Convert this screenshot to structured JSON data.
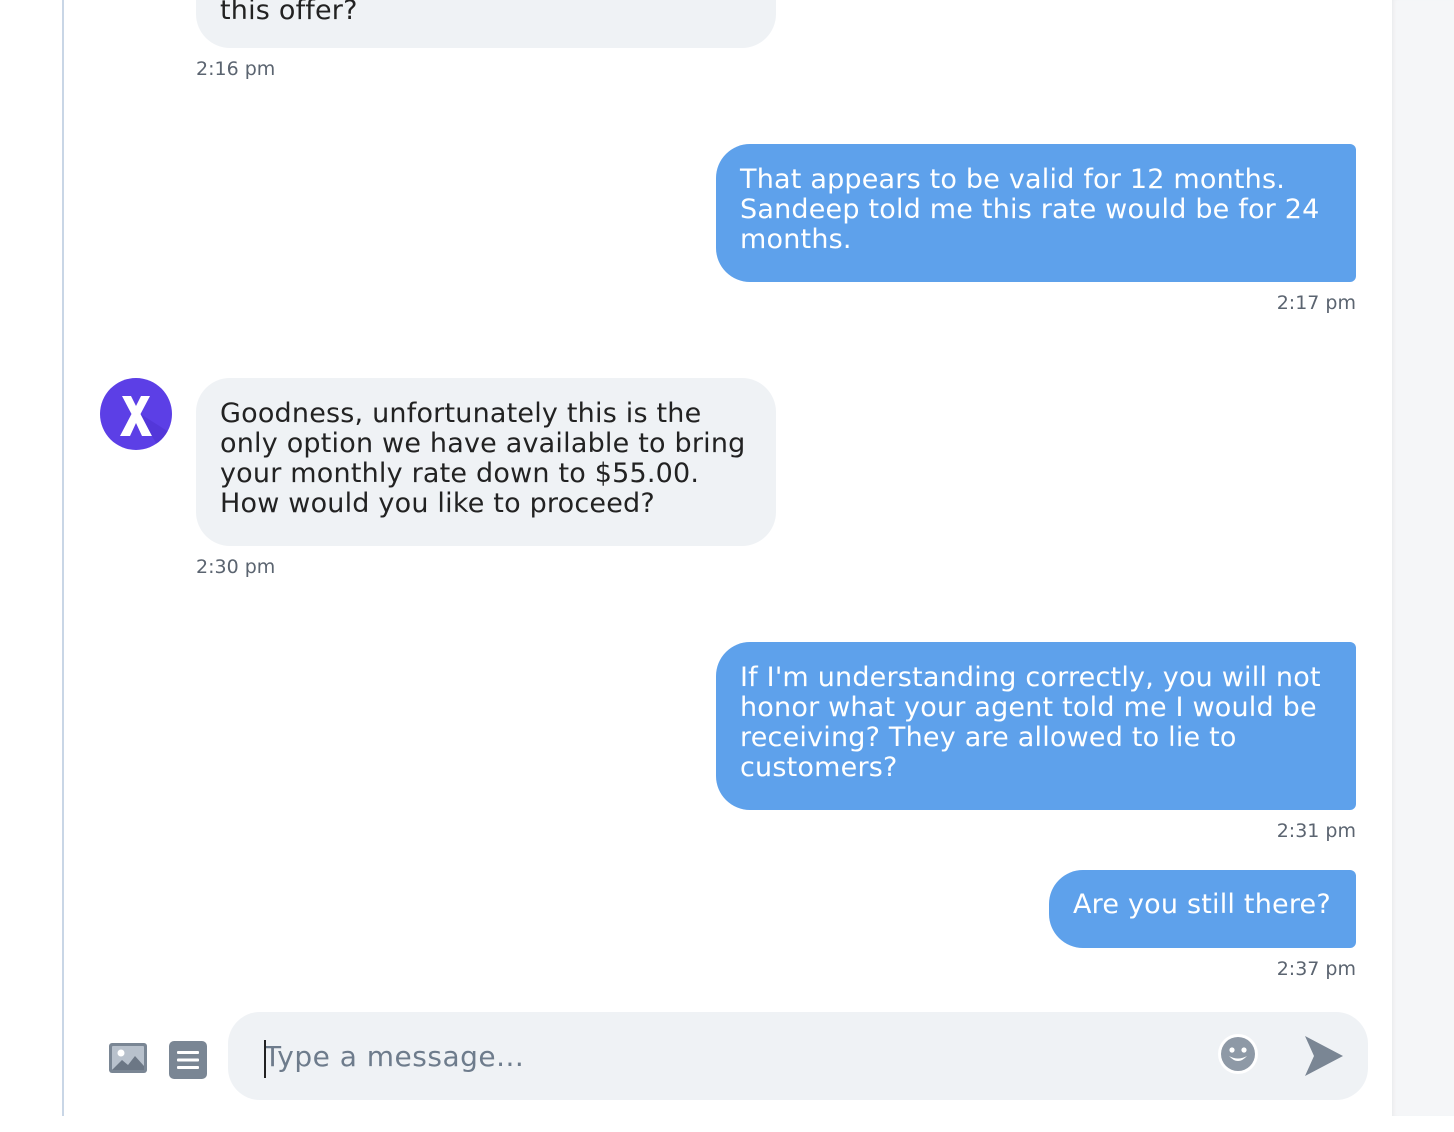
{
  "chat": {
    "messages": [
      {
        "sender": "agent",
        "lines": [
          "this offer?"
        ],
        "time": "2:16 pm"
      },
      {
        "sender": "user",
        "lines": [
          "That appears to be valid for 12 months.",
          "Sandeep told me this rate would be for 24",
          "months."
        ],
        "time": "2:17 pm"
      },
      {
        "sender": "agent",
        "lines": [
          "Goodness, unfortunately this is the",
          "only option we have available to bring",
          "your monthly rate down to $55.00.",
          "How would you like to proceed?"
        ],
        "time": "2:30 pm"
      },
      {
        "sender": "user",
        "lines": [
          "If I'm understanding correctly, you will not",
          "honor what your agent told me I would be",
          "receiving? They are allowed to lie to",
          "customers?"
        ],
        "time": "2:31 pm"
      },
      {
        "sender": "user",
        "lines": [
          "Are you still there?"
        ],
        "time": "2:37 pm"
      }
    ]
  },
  "composer": {
    "placeholder": "Type a message...",
    "value": ""
  },
  "icons": {
    "avatar": "xfinity-x-logo",
    "image_upload": "image-icon",
    "document": "document-icon",
    "emoji": "smiley-icon",
    "send": "send-arrow-icon"
  },
  "colors": {
    "user_bubble": "#5ea1eb",
    "agent_bubble": "#eff2f5",
    "avatar_bg": "#5c3fe6",
    "timestamp": "#5b6470"
  }
}
